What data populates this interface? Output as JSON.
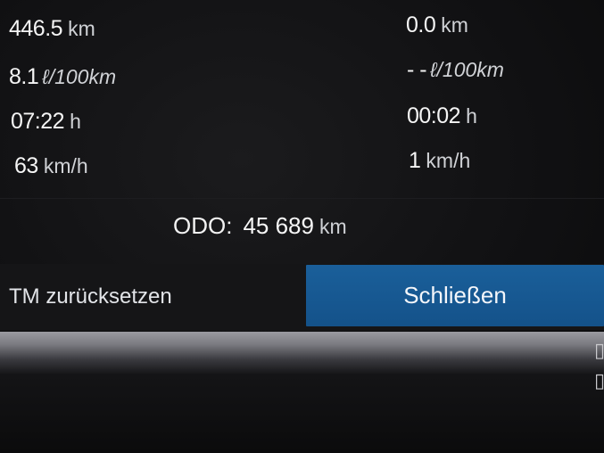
{
  "trip_left": {
    "distance": {
      "value": "446.5",
      "unit": "km"
    },
    "consumption": {
      "value": "8.1",
      "unit": "ℓ/100km"
    },
    "time": {
      "value": "07:22",
      "unit": "h"
    },
    "speed": {
      "value": "63",
      "unit": "km/h"
    }
  },
  "trip_right": {
    "distance": {
      "value": "0.0",
      "unit": "km"
    },
    "consumption": {
      "value": "- -",
      "unit": "ℓ/100km"
    },
    "time": {
      "value": "00:02",
      "unit": "h"
    },
    "speed": {
      "value": "1",
      "unit": "km/h"
    }
  },
  "odometer": {
    "label": "ODO:",
    "value": "45 689",
    "unit": "km"
  },
  "buttons": {
    "reset_label": "TM zurücksetzen",
    "close_label": "Schließen"
  },
  "colors": {
    "background": "#111113",
    "primary_button": "#14528a",
    "text": "#ffffff"
  }
}
